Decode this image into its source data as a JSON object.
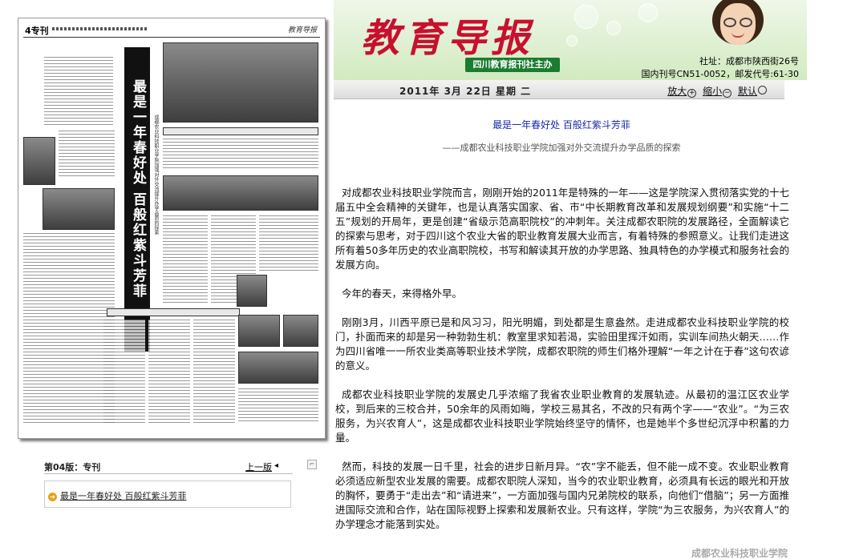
{
  "header": {
    "title": "教育导报",
    "organizer": "四川教育报刊社主办",
    "address": "社址：成都市陕西街26号",
    "issn": "国内刊号CN51-0052，邮发代号:61-30"
  },
  "datebar": {
    "date": "2011年 3月 22日  星期 二",
    "zoom_in": "放大",
    "zoom_out": "缩小",
    "zoom_default": "默认"
  },
  "newspaper": {
    "page_mark": "4专刊",
    "logo": "教育导报",
    "headline": "最是一年春好处 百般红紫斗芳菲",
    "subheadline": "成都农业科技职业学院加强对外交流提升办学品质的探索"
  },
  "pager": {
    "label": "第04版：专刊",
    "prev": "上一版"
  },
  "articles": [
    {
      "title": "最是一年春好处  百般红紫斗芳菲"
    }
  ],
  "article": {
    "title": "最是一年春好处  百般红紫斗芳菲",
    "subtitle": "——成都农业科技职业学院加强对外交流提升办学品质的探索",
    "paragraphs": [
      "对成都农业科技职业学院而言，刚刚开始的2011年是特殊的一年——这是学院深入贯彻落实党的十七届五中全会精神的关键年，也是认真落实国家、省、市“中长期教育改革和发展规划纲要”和实施“十二五”规划的开局年，更是创建“省级示范高职院校”的冲刺年。关注成都农职院的发展路径，全面解读它的探索与思考，对于四川这个农业大省的职业教育发展大业而言，有着特殊的参照意义。让我们走进这所有着50多年历史的农业高职院校，书写和解读其开放的办学思路、独具特色的办学模式和服务社会的发展方向。",
      "今年的春天，来得格外早。",
      "刚刚3月，川西平原已是和风习习，阳光明媚，到处都是生意盎然。走进成都农业科技职业学院的校门，扑面而来的却是另一种勃勃生机：教室里求知若渴，实验田里挥汗如雨，实训车间热火朝天……作为四川省唯一一所农业类高等职业技术学院，成都农职院的师生们格外理解“一年之计在于春”这句农谚的意义。",
      "成都农业科技职业学院的发展史几乎浓缩了我省农业职业教育的发展轨迹。从最初的温江区农业学校，到后来的三校合并，50余年的风雨如晦，学校三易其名，不改的只有两个字——“农业”。“为三农服务，为兴农育人”，这是成都农业科技职业学院始终坚守的情怀，也是她半个多世纪沉浮中积蓄的力量。",
      "然而，科技的发展一日千里，社会的进步日新月异。“农”字不能丢，但不能一成不变。农业职业教育必须适应新型农业发展的需要。成都农职院人深知，当今的农业职业教育，必须具有长远的眼光和开放的胸怀，要勇于“走出去”和“请进来”，一方面加强与国内兄弟院校的联系，向他们“借脑”；另一方面推进国际交流和合作，站在国际视野上探索和发展新农业。只有这样，学院“为三农服务，为兴农育人”的办学理念才能落到实处。"
    ],
    "footer": "成都农业科技职业学院"
  },
  "colors": {
    "title_red": "#c8102e",
    "org_green": "#1a7c2f",
    "link_blue": "#1a2aa8",
    "bullet_orange": "#e6a21a"
  }
}
